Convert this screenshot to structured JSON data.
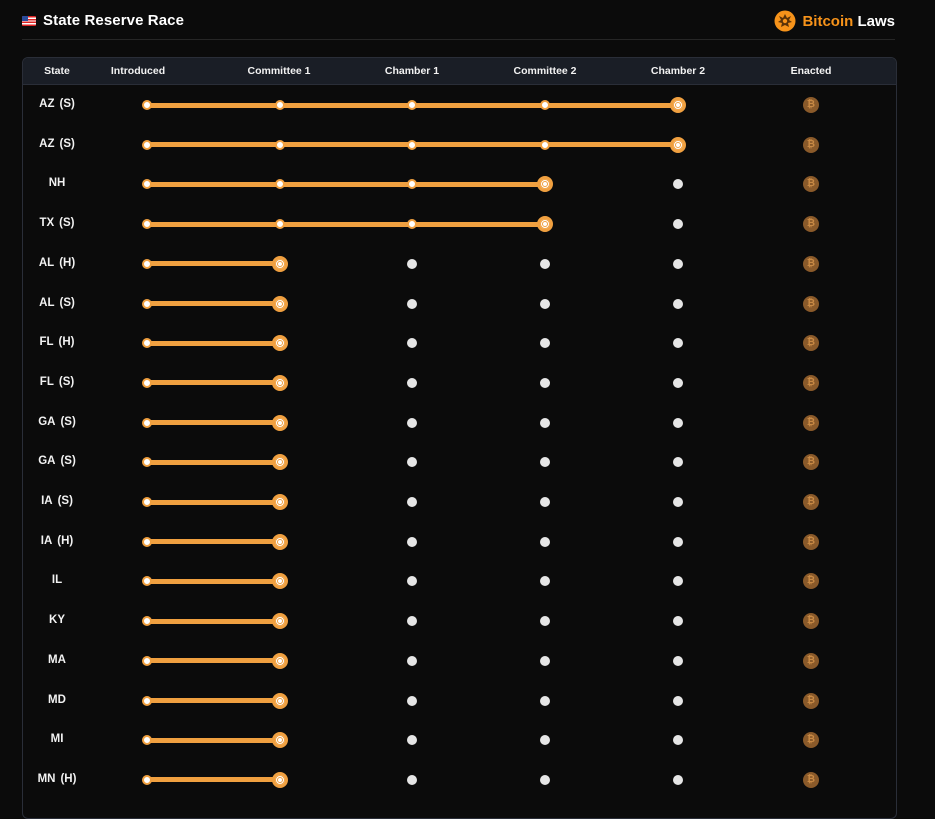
{
  "header": {
    "title": "State Reserve Race",
    "brand_part1": "Bitcoin",
    "brand_part2": "Laws",
    "flag_icon": "us-flag-icon",
    "logo_icon": "bitcoin-laws-seal-icon"
  },
  "colors": {
    "accent": "#f0a040",
    "brand": "#f7931a",
    "pending_dot": "#e6e6e6",
    "enacted_icon": "#8a5a2a"
  },
  "table": {
    "columns": [
      "State",
      "Introduced",
      "Committee 1",
      "Chamber 1",
      "Committee 2",
      "Chamber 2",
      "Enacted"
    ],
    "stages": [
      "Introduced",
      "Committee 1",
      "Chamber 1",
      "Committee 2",
      "Chamber 2"
    ],
    "enacted_icon": "bitcoin-icon",
    "rows": [
      {
        "state": "AZ",
        "chamber": "(S)",
        "stage_reached": 5
      },
      {
        "state": "AZ",
        "chamber": "(S)",
        "stage_reached": 5
      },
      {
        "state": "NH",
        "chamber": "",
        "stage_reached": 4
      },
      {
        "state": "TX",
        "chamber": "(S)",
        "stage_reached": 4
      },
      {
        "state": "AL",
        "chamber": "(H)",
        "stage_reached": 2
      },
      {
        "state": "AL",
        "chamber": "(S)",
        "stage_reached": 2
      },
      {
        "state": "FL",
        "chamber": "(H)",
        "stage_reached": 2
      },
      {
        "state": "FL",
        "chamber": "(S)",
        "stage_reached": 2
      },
      {
        "state": "GA",
        "chamber": "(S)",
        "stage_reached": 2
      },
      {
        "state": "GA",
        "chamber": "(S)",
        "stage_reached": 2
      },
      {
        "state": "IA",
        "chamber": "(S)",
        "stage_reached": 2
      },
      {
        "state": "IA",
        "chamber": "(H)",
        "stage_reached": 2
      },
      {
        "state": "IL",
        "chamber": "",
        "stage_reached": 2
      },
      {
        "state": "KY",
        "chamber": "",
        "stage_reached": 2
      },
      {
        "state": "MA",
        "chamber": "",
        "stage_reached": 2
      },
      {
        "state": "MD",
        "chamber": "",
        "stage_reached": 2
      },
      {
        "state": "MI",
        "chamber": "",
        "stage_reached": 2
      },
      {
        "state": "MN",
        "chamber": "(H)",
        "stage_reached": 2
      }
    ]
  }
}
